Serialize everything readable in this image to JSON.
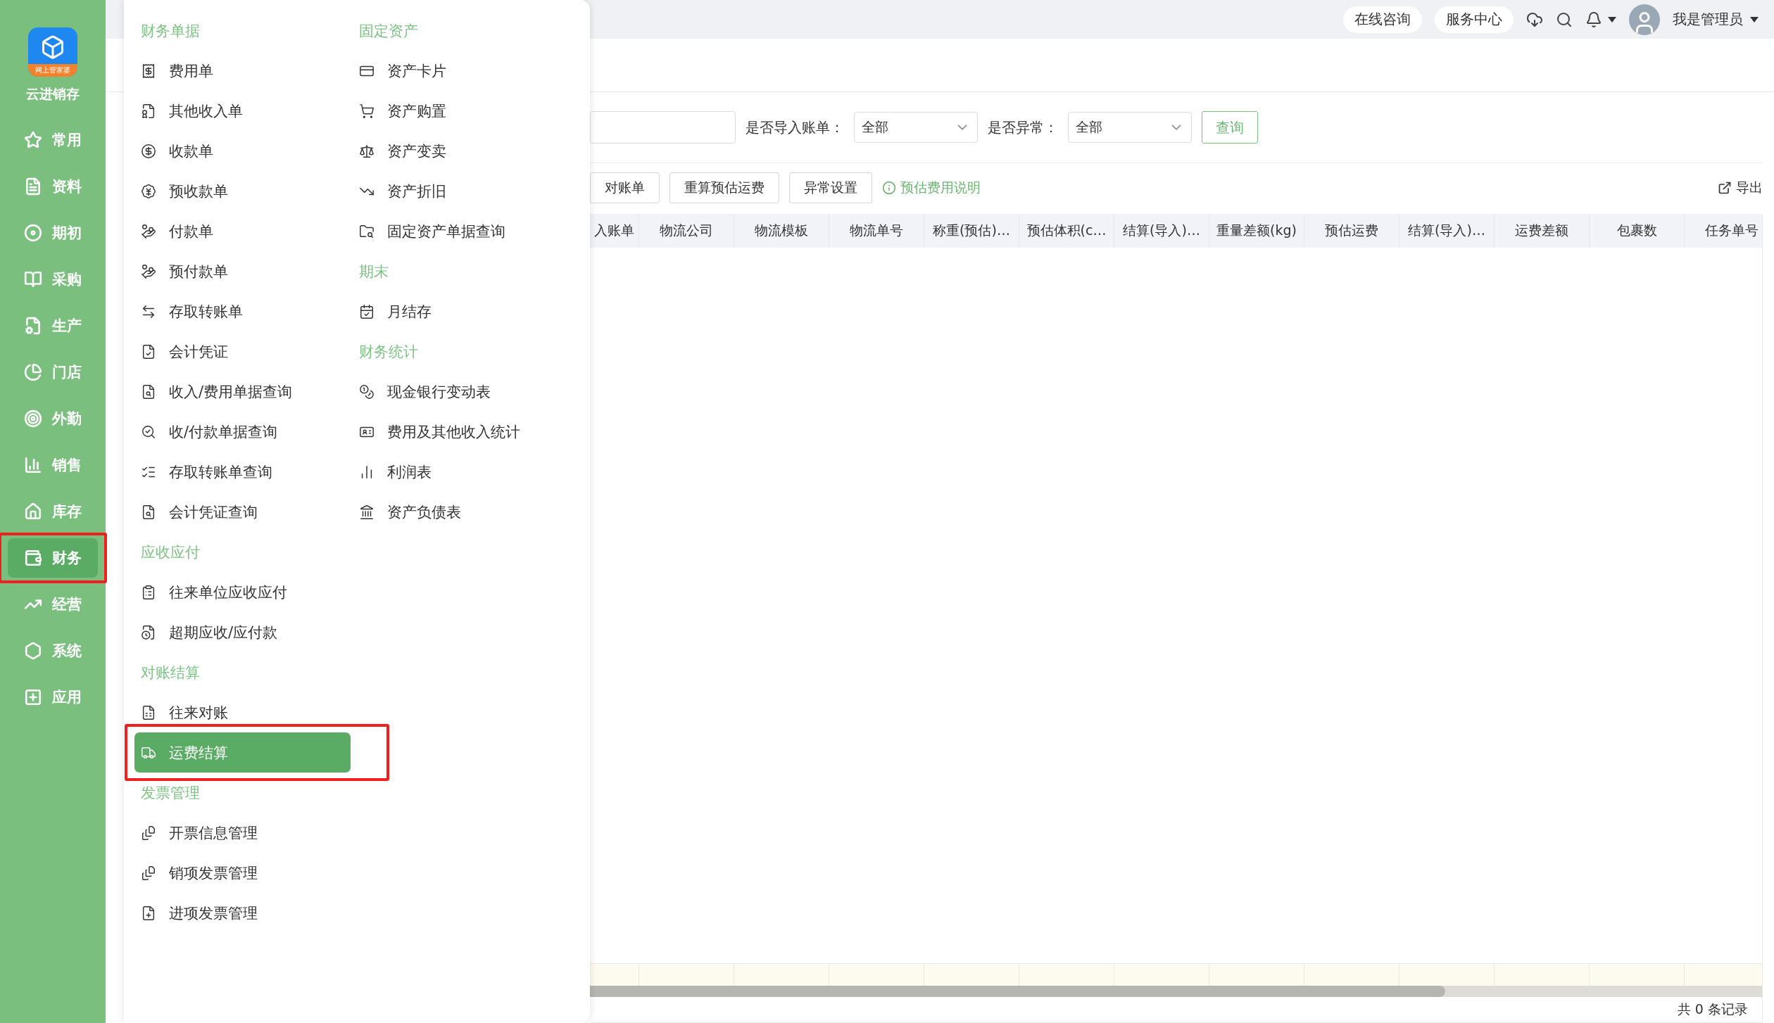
{
  "sidebar": {
    "logo_badge": "网上管家婆",
    "app_name": "云进销存",
    "items": [
      {
        "label": "常用",
        "selected": false
      },
      {
        "label": "资料",
        "selected": false
      },
      {
        "label": "期初",
        "selected": false
      },
      {
        "label": "采购",
        "selected": false
      },
      {
        "label": "生产",
        "selected": false
      },
      {
        "label": "门店",
        "selected": false
      },
      {
        "label": "外勤",
        "selected": false
      },
      {
        "label": "销售",
        "selected": false
      },
      {
        "label": "库存",
        "selected": false
      },
      {
        "label": "财务",
        "selected": true
      },
      {
        "label": "经营",
        "selected": false
      },
      {
        "label": "系统",
        "selected": false
      },
      {
        "label": "应用",
        "selected": false
      }
    ]
  },
  "top_bar": {
    "buttons": [
      "在线咨询",
      "服务中心"
    ],
    "user": "我是管理员"
  },
  "menu": {
    "columns": [
      [
        {
          "title": "财务单据",
          "items": [
            {
              "label": "费用单",
              "selected": false
            },
            {
              "label": "其他收入单",
              "selected": false
            },
            {
              "label": "收款单",
              "selected": false
            },
            {
              "label": "预收款单",
              "selected": false
            },
            {
              "label": "付款单",
              "selected": false
            },
            {
              "label": "预付款单",
              "selected": false
            },
            {
              "label": "存取转账单",
              "selected": false
            },
            {
              "label": "会计凭证",
              "selected": false
            },
            {
              "label": "收入/费用单据查询",
              "selected": false
            },
            {
              "label": "收/付款单据查询",
              "selected": false
            },
            {
              "label": "存取转账单查询",
              "selected": false
            },
            {
              "label": "会计凭证查询",
              "selected": false
            }
          ]
        },
        {
          "title": "应收应付",
          "items": [
            {
              "label": "往来单位应收应付",
              "selected": false
            },
            {
              "label": "超期应收/应付款",
              "selected": false
            }
          ]
        },
        {
          "title": "对账结算",
          "items": [
            {
              "label": "往来对账",
              "selected": false
            },
            {
              "label": "运费结算",
              "selected": true
            }
          ]
        },
        {
          "title": "发票管理",
          "items": [
            {
              "label": "开票信息管理",
              "selected": false
            },
            {
              "label": "销项发票管理",
              "selected": false
            },
            {
              "label": "进项发票管理",
              "selected": false
            }
          ]
        }
      ],
      [
        {
          "title": "固定资产",
          "items": [
            {
              "label": "资产卡片",
              "selected": false
            },
            {
              "label": "资产购置",
              "selected": false
            },
            {
              "label": "资产变卖",
              "selected": false
            },
            {
              "label": "资产折旧",
              "selected": false
            },
            {
              "label": "固定资产单据查询",
              "selected": false
            }
          ]
        },
        {
          "title": "期末",
          "items": [
            {
              "label": "月结存",
              "selected": false
            }
          ]
        },
        {
          "title": "财务统计",
          "items": [
            {
              "label": "现金银行变动表",
              "selected": false
            },
            {
              "label": "费用及其他收入统计",
              "selected": false
            },
            {
              "label": "利润表",
              "selected": false
            },
            {
              "label": "资产负债表",
              "selected": false
            }
          ]
        }
      ]
    ]
  },
  "filters": [
    {
      "label": "是否导入账单：",
      "value": "全部"
    },
    {
      "label": "是否异常：",
      "value": "全部"
    }
  ],
  "query_button": "查询",
  "toolbar": {
    "buttons": [
      "对账单",
      "重算预估运费",
      "异常设置"
    ],
    "info_link": "预估费用说明",
    "export": "导出"
  },
  "table": {
    "columns": [
      "入账单",
      "物流公司",
      "物流模板",
      "物流单号",
      "称重(预估)…",
      "预估体积(c…",
      "结算(导入)…",
      "重量差额(kg)",
      "预估运费",
      "结算(导入)…",
      "运费差额",
      "包裹数",
      "任务单号"
    ]
  },
  "footer": {
    "count": "共 0 条记录"
  }
}
